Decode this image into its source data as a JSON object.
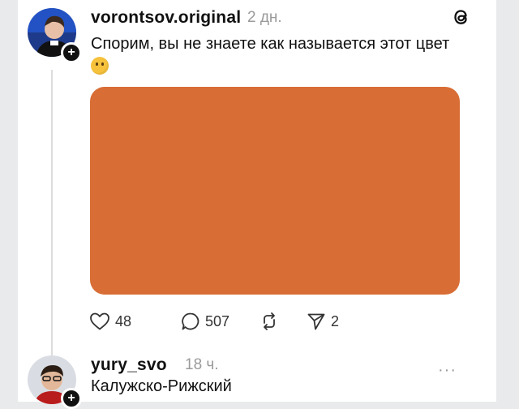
{
  "post": {
    "username": "vorontsov.original",
    "time": "2 дн.",
    "text": "Спорим, вы не знаете как называется этот цвет",
    "emoji": "thinking-face",
    "swatch_color": "#d86d35",
    "likes": "48",
    "comments": "507",
    "shares": "2"
  },
  "reply": {
    "username": "yury_svo",
    "time": "18 ч.",
    "text": "Калужско-Рижский",
    "menu": "···"
  },
  "icons": {
    "like": "heart-icon",
    "comment": "comment-icon",
    "repost": "repost-icon",
    "share": "send-icon",
    "app": "threads-logo-icon",
    "follow": "plus-icon"
  }
}
